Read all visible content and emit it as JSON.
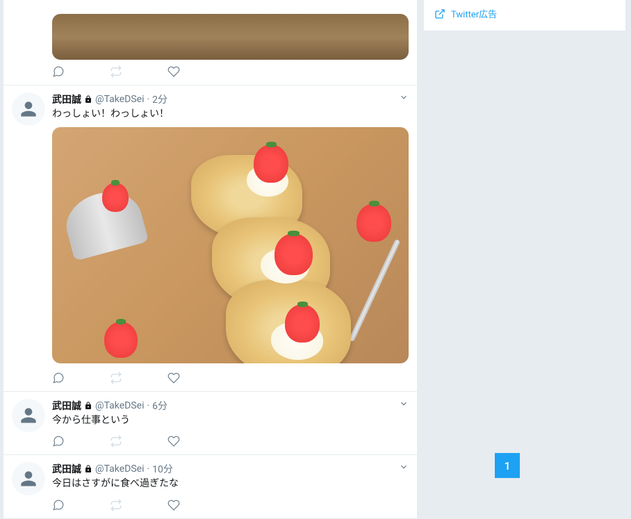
{
  "sidebar": {
    "twitter_ad_label": "Twitter広告"
  },
  "tweets": [
    {
      "name": "武田誠",
      "handle": "@TakeDSei",
      "time": "2分",
      "text": "わっしょい！わっしょい！",
      "has_image": true
    },
    {
      "name": "武田誠",
      "handle": "@TakeDSei",
      "time": "6分",
      "text": "今から仕事という",
      "has_image": false
    },
    {
      "name": "武田誠",
      "handle": "@TakeDSei",
      "time": "10分",
      "text": "今日はさすがに食べ過ぎたな",
      "has_image": false
    }
  ],
  "page_number": "1",
  "dot": "·"
}
